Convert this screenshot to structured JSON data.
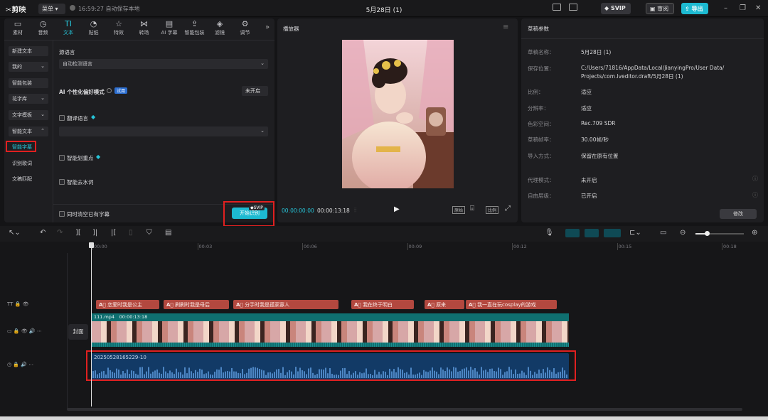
{
  "app": {
    "logo": "✂剪映",
    "menu": "菜单 ▾",
    "save_status": "16:59:27 自动保存本地",
    "project_title": "5月28日 (1)",
    "svip": "SVIP",
    "review": "审阅",
    "export": "导出"
  },
  "tabs": [
    {
      "label": "素材",
      "icon": "▭"
    },
    {
      "label": "音频",
      "icon": "◷"
    },
    {
      "label": "文本",
      "icon": "TI"
    },
    {
      "label": "贴纸",
      "icon": "◔"
    },
    {
      "label": "特效",
      "icon": "☆"
    },
    {
      "label": "转场",
      "icon": "⋈"
    },
    {
      "label": "AI 字幕",
      "icon": "▤"
    },
    {
      "label": "智能包装",
      "icon": "⇪"
    },
    {
      "label": "滤镜",
      "icon": "◈"
    },
    {
      "label": "调节",
      "icon": "⚙"
    }
  ],
  "sidebar": [
    {
      "label": "新建文本",
      "style": "item"
    },
    {
      "label": "我的",
      "style": "item",
      "chevron": "⌄"
    },
    {
      "label": "智能包装",
      "style": "item"
    },
    {
      "label": "花字库",
      "style": "item",
      "chevron": "⌄"
    },
    {
      "label": "文字模板",
      "style": "item",
      "chevron": "⌄"
    },
    {
      "label": "智能文本",
      "style": "item",
      "chevron": "⌃"
    },
    {
      "label": "智能字幕",
      "style": "active"
    },
    {
      "label": "识别歌词",
      "style": "plain"
    },
    {
      "label": "文稿匹配",
      "style": "plain"
    }
  ],
  "settings": {
    "source_lang_label": "源语言",
    "source_lang_value": "自动检测语言",
    "ai_mode_label": "AI 个性化偏好模式",
    "ai_mode_badge": "试用",
    "ai_mode_value": "未开启",
    "translate_label": "翻译语言",
    "highlight_label": "智能划重点",
    "filler_label": "智能去水词",
    "clear_label": "同时清空已有字幕",
    "start_button": "开始识别",
    "start_svip": "SVIP"
  },
  "player": {
    "title": "播放器",
    "time_current": "00:00:00:00",
    "time_total": "00:00:13:18",
    "btn_original": "原始",
    "btn_ratio": "比例"
  },
  "props": {
    "title": "草稿参数",
    "rows": [
      {
        "label": "草稿名称：",
        "value": "5月28日 (1)"
      },
      {
        "label": "保存位置：",
        "value": "C:/Users/71816/AppData/Local/JianyingPro/User Data/",
        "value2": "Projects/com.lveditor.draft/5月28日 (1)"
      },
      {
        "label": "比例：",
        "value": "适应"
      },
      {
        "label": "分辨率：",
        "value": "适应"
      },
      {
        "label": "色彩空间：",
        "value": "Rec.709 SDR"
      },
      {
        "label": "草稿帧率：",
        "value": "30.00帧/秒"
      },
      {
        "label": "导入方式：",
        "value": "保留在原有位置"
      },
      {
        "label": "代理模式：",
        "value": "未开启"
      },
      {
        "label": "自由层级：",
        "value": "已开启"
      }
    ],
    "edit_button": "修改"
  },
  "ruler": [
    "00:00",
    "00:03",
    "00:06",
    "00:09",
    "00:12",
    "00:15",
    "00:18"
  ],
  "captions": [
    "恋爱时我是公主",
    "刷刷时我是母后",
    "分手时我是孤家寡人",
    "我在终于明白",
    "原来",
    "我一直在玩cosplay的游戏"
  ],
  "video_clip": {
    "name": "111.mp4",
    "duration": "00:00:13:18",
    "cover": "封面"
  },
  "audio_clip": {
    "name": "20250528165229-10"
  },
  "colors": {
    "accent": "#1dbad1",
    "caption": "#b3483f",
    "audio": "#123a66",
    "video_bar": "#0f6f70",
    "red_box": "#e02020"
  }
}
